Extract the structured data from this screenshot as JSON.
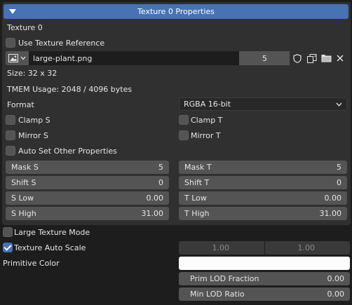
{
  "panel": {
    "title": "Texture 0 Properties",
    "texture_label": "Texture 0",
    "use_reference_label": "Use Texture Reference",
    "image_name": "large-plant.png",
    "user_count": "5",
    "size_text": "Size: 32 x 32",
    "tmem_text": "TMEM Usage: 2048 / 4096 bytes",
    "format_label": "Format",
    "format_value": "RGBA 16-bit",
    "clamp_s": "Clamp S",
    "clamp_t": "Clamp T",
    "mirror_s": "Mirror S",
    "mirror_t": "Mirror T",
    "auto_set_label": "Auto Set Other Properties",
    "mask_s": {
      "label": "Mask S",
      "value": "5"
    },
    "mask_t": {
      "label": "Mask T",
      "value": "5"
    },
    "shift_s": {
      "label": "Shift S",
      "value": "0"
    },
    "shift_t": {
      "label": "Shift T",
      "value": "0"
    },
    "s_low": {
      "label": "S Low",
      "value": "0.00"
    },
    "t_low": {
      "label": "T Low",
      "value": "0.00"
    },
    "s_high": {
      "label": "S High",
      "value": "31.00"
    },
    "t_high": {
      "label": "T High",
      "value": "31.00"
    }
  },
  "lower": {
    "large_texture_label": "Large Texture Mode",
    "auto_scale_label": "Texture Auto Scale",
    "scale_s": "1.00",
    "scale_t": "1.00",
    "prim_color_label": "Primitive Color",
    "prim_color": "#fcfcfc",
    "prim_lod": {
      "label": "Prim LOD Fraction",
      "value": "0.00"
    },
    "min_lod": {
      "label": "Min LOD Ratio",
      "value": "0.00"
    }
  },
  "state": {
    "use_reference": false,
    "clamp_s": false,
    "clamp_t": false,
    "mirror_s": false,
    "mirror_t": false,
    "auto_set": false,
    "large_texture": false,
    "auto_scale": true
  },
  "icons": [
    "image-icon",
    "chevron-down-icon",
    "fake-user-shield-icon",
    "duplicate-icon",
    "folder-icon",
    "close-icon"
  ],
  "colors": {
    "accent": "#4772b3",
    "panel": "#303030",
    "field": "#545454",
    "background": "#1d1d1d"
  }
}
